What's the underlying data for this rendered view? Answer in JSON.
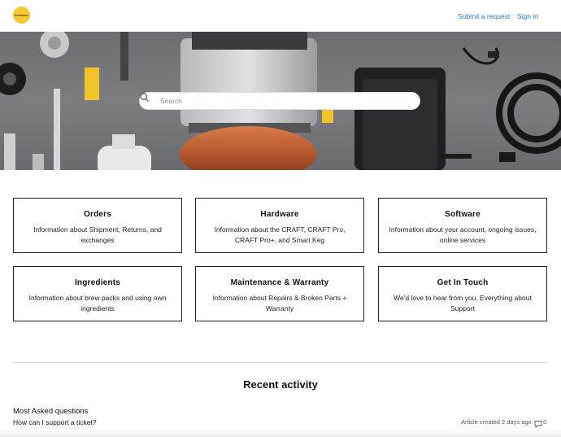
{
  "header": {
    "logo_text": "brewery",
    "nav": {
      "submit_request": "Submit a request",
      "sign_in": "Sign in"
    }
  },
  "hero": {
    "search_placeholder": "Search"
  },
  "categories": [
    {
      "title": "Orders",
      "description": "Information about Shipment, Returns, and exchanges"
    },
    {
      "title": "Hardware",
      "description": "Information about the CRAFT, CRAFT Pro, CRAFT Pro+, and Smart Keg"
    },
    {
      "title": "Software",
      "description": "Information about your account, ongoing issues, online services"
    },
    {
      "title": "Ingredients",
      "description": "Information about brew packs and using own ingredients"
    },
    {
      "title": "Maintenance & Warranty",
      "description": "Information about Repairs & Broken Parts + Warranty"
    },
    {
      "title": "Get In Touch",
      "description": "We'd love to hear from you. Everything about Support"
    }
  ],
  "recent_activity": {
    "title": "Recent activity",
    "section": "Most Asked questions",
    "items": [
      {
        "title": "How can I support a ticket?",
        "meta": "Article created 2 days ago",
        "comments": "0"
      }
    ]
  },
  "colors": {
    "link": "#2d78c8",
    "logo": "#f6c935",
    "copper": "#b4572e"
  }
}
